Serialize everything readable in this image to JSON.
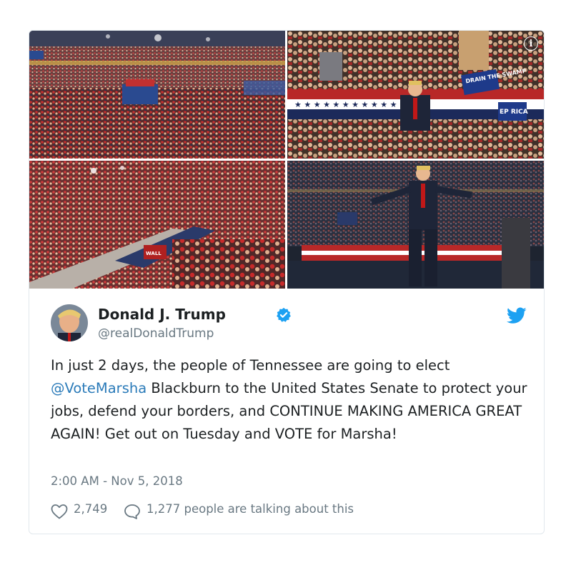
{
  "tweet": {
    "author_name": "Donald J. Trump",
    "handle": "@realDonaldTrump",
    "text_parts": {
      "before_mention": "In just 2 days, the people of Tennessee are going to elect ",
      "mention": "@VoteMarsha",
      "after_mention": " Blackburn to the United States Senate to protect your jobs, defend your borders, and CONTINUE MAKING AMERICA GREAT AGAIN! Get out on Tuesday and VOTE for Marsha!"
    },
    "timestamp": "2:00 AM - Nov 5, 2018",
    "like_count": "2,749",
    "conversation_text": "1,277 people are talking about this"
  },
  "media": {
    "info_symbol": "i",
    "sign_text_drain": "DRAIN THE SWAMP",
    "sign_text_keep": "EP RICA",
    "sign_text_wall": "WALL",
    "photos": [
      {
        "icon": "photo-arena-crowd"
      },
      {
        "icon": "photo-speaker-stage"
      },
      {
        "icon": "photo-arena-floor"
      },
      {
        "icon": "photo-speaker-arms"
      }
    ]
  },
  "icons": {
    "verified": "verified-badge-icon",
    "brand": "twitter-bird-icon",
    "like": "heart-icon",
    "conversation": "speech-bubble-icon",
    "info": "info-icon"
  },
  "colors": {
    "link": "#2b7bb9",
    "verified": "#1da1f2",
    "muted": "#697882",
    "text": "#1c2022",
    "border": "#e1e8ed"
  }
}
